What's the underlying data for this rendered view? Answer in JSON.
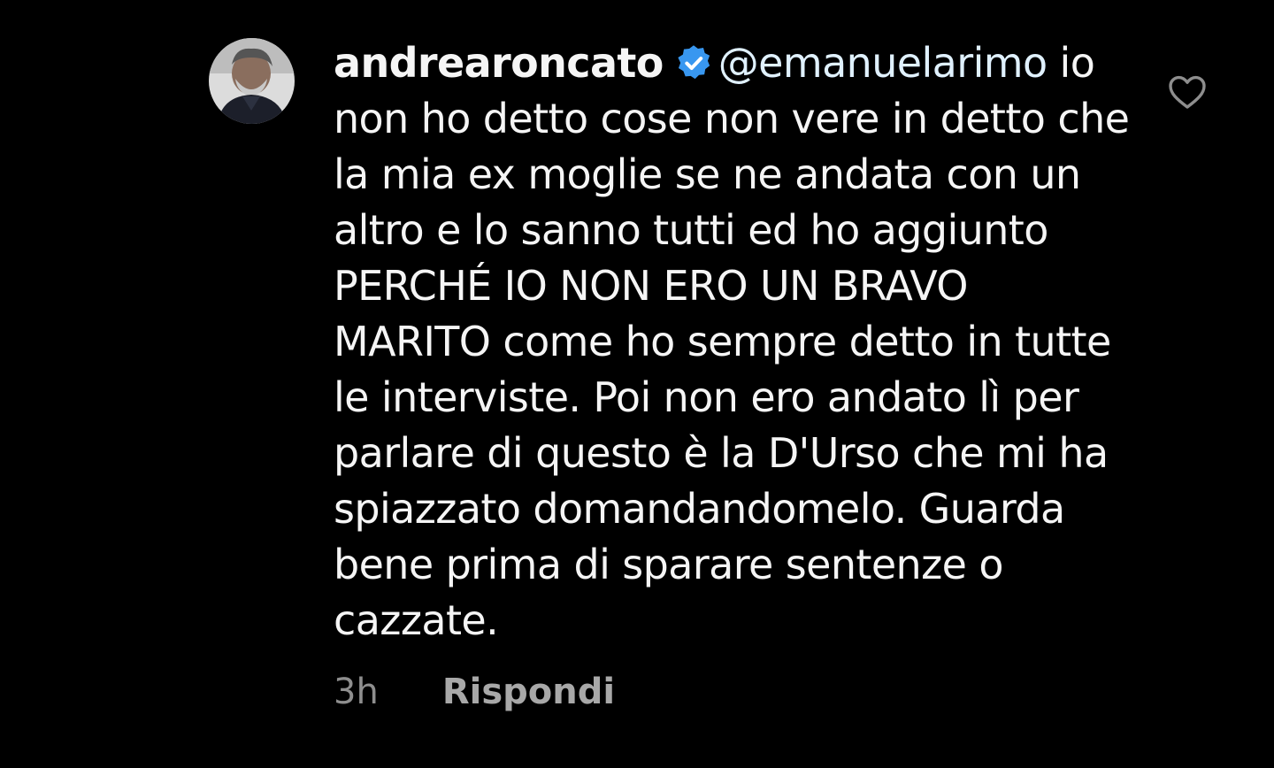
{
  "comment": {
    "username": "andrearoncato",
    "mention": "@emanuelarimo",
    "text": " io non ho detto cose non vere in detto che la mia ex moglie se ne andata con un altro e lo sanno tutti ed ho aggiunto PERCHÉ IO NON ERO UN BRAVO MARITO come ho sempre detto in tutte le interviste. Poi non ero andato lì per parlare di questo è la D'Urso che mi ha spiazzato domandandomelo. Guarda bene prima di sparare sentenze o cazzate.",
    "time_ago": "3h",
    "reply_label": "Rispondi",
    "verified": true
  },
  "icons": {
    "verified": "verified-badge-icon",
    "like": "heart-outline-icon"
  },
  "colors": {
    "background": "#000000",
    "text": "#f5f5f5",
    "meta": "#8e8e8e",
    "verified_badge": "#3897f0"
  }
}
